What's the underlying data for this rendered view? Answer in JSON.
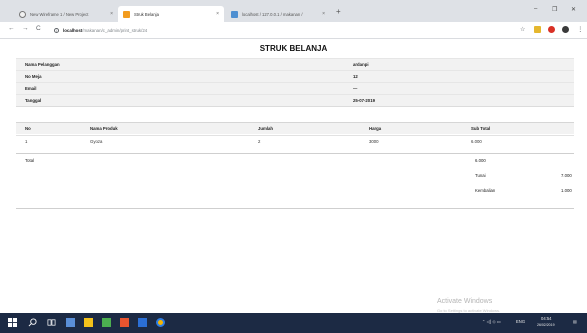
{
  "browser": {
    "tabs": [
      {
        "title": "New Wireframe 1 / New Project",
        "close": "×"
      },
      {
        "title": "Struk Belanja",
        "close": "×"
      },
      {
        "title": "localhost / 127.0.0.1 / makanan /",
        "close": "×"
      }
    ],
    "new_tab": "+",
    "window_controls": {
      "minimize": "–",
      "maximize": "❐",
      "close": "✕"
    },
    "nav": {
      "back": "←",
      "forward": "→",
      "reload": "C"
    },
    "address": {
      "info": "i",
      "host": "localhost",
      "path": "/makanan/c_admin/print_struk/24"
    }
  },
  "receipt": {
    "title": "STRUK BELANJA",
    "info": [
      {
        "label": "Nama Pelanggan",
        "value": "ardanpi"
      },
      {
        "label": "No Meja",
        "value": "12"
      },
      {
        "label": "Email",
        "value": "—"
      },
      {
        "label": "Tanggal",
        "value": "25-07-2019"
      }
    ],
    "columns": [
      "No",
      "Nama Produk",
      "Jumlah",
      "Harga",
      "Sub Total"
    ],
    "items": [
      {
        "no": "1",
        "produk": "Gyoza",
        "jumlah": "2",
        "harga": "3000",
        "subtotal": "6.000"
      }
    ],
    "total_label": "Total",
    "total_value": "6.000",
    "tunai_label": "Tunai",
    "tunai_value": "7.000",
    "kembalian_label": "Kembalian",
    "kembalian_value": "1.000"
  },
  "watermark": {
    "line1": "Activate Windows",
    "line2": "Go to Settings to activate Windows."
  },
  "taskbar": {
    "tray": "ENG",
    "time": "04:54",
    "date": "26/02/2019"
  }
}
